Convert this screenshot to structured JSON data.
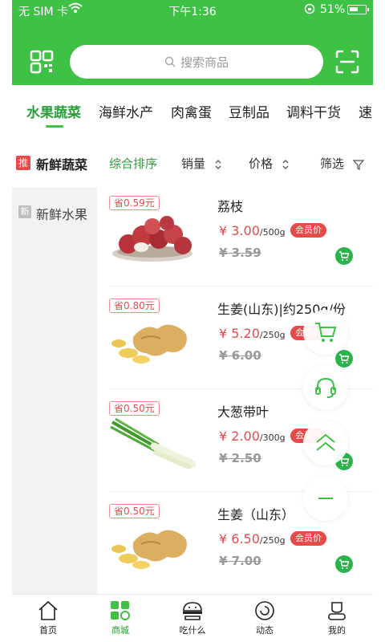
{
  "status_bar": {
    "carrier": "无 SIM 卡",
    "time": "下午1:36",
    "battery": "51%"
  },
  "header": {
    "search_placeholder": "搜索商品",
    "qr_icon": "qr-code-icon",
    "scan_icon": "scan-icon"
  },
  "categories": [
    {
      "label": "水果蔬菜",
      "active": true
    },
    {
      "label": "海鲜水产",
      "active": false
    },
    {
      "label": "肉禽蛋",
      "active": false
    },
    {
      "label": "豆制品",
      "active": false
    },
    {
      "label": "调料干货",
      "active": false
    },
    {
      "label": "速",
      "active": false
    }
  ],
  "sortbar": {
    "badge": "推",
    "title": "新鲜蔬菜",
    "sorts": [
      "综合排序",
      "销量",
      "价格",
      "筛选"
    ],
    "active_sort": "综合排序"
  },
  "side": {
    "badge": "新",
    "label": "新鲜水果"
  },
  "products": [
    {
      "saving": "省0.59元",
      "name": "荔枝",
      "price": "¥ 3.00",
      "unit": "/500g",
      "vip": "会员价",
      "original": "¥ 3.59"
    },
    {
      "saving": "省0.80元",
      "name": "生姜(山东)|约250g/份",
      "price": "¥ 5.20",
      "unit": "/250g",
      "vip": "会员价",
      "original": "¥ 6.00"
    },
    {
      "saving": "省0.50元",
      "name": "大葱带叶",
      "price": "¥ 2.00",
      "unit": "/300g",
      "vip": "会员价",
      "original": "¥ 2.50"
    },
    {
      "saving": "省0.50元",
      "name": "生姜（山东）",
      "price": "¥ 6.50",
      "unit": "/250g",
      "vip": "会员价",
      "original": "¥ 7.00"
    }
  ],
  "bottom_nav": [
    {
      "label": "首页",
      "icon": "home-icon",
      "active": false
    },
    {
      "label": "商城",
      "icon": "mall-icon",
      "active": true
    },
    {
      "label": "吃什么",
      "icon": "food-icon",
      "active": false
    },
    {
      "label": "动态",
      "icon": "feed-icon",
      "active": false
    },
    {
      "label": "我的",
      "icon": "profile-icon",
      "active": false
    }
  ],
  "colors": {
    "brand_green": "#3fc146",
    "active_text_green": "#2a9d3a",
    "price_red": "#e94949"
  }
}
